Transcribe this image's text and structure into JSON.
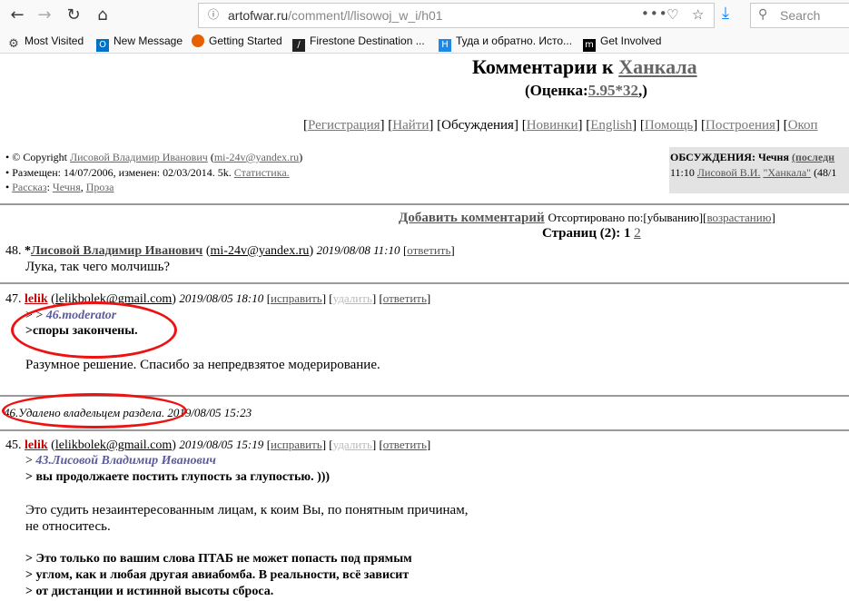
{
  "browser": {
    "url_host": "artofwar.ru",
    "url_path": "/comment/l/lisowoj_w_i/h01",
    "more_icon": "•••",
    "search_placeholder": "Search"
  },
  "bookmarks": [
    {
      "label": "Most Visited",
      "icon": "gear-icon"
    },
    {
      "label": "New Message",
      "icon": "outlook-icon"
    },
    {
      "label": "Getting Started",
      "icon": "firefox-icon"
    },
    {
      "label": "Firestone Destination ...",
      "icon": "firestone-icon"
    },
    {
      "label": "Туда и обратно. Исто...",
      "icon": "bookmark-site-icon"
    },
    {
      "label": "Get Involved",
      "icon": "mozilla-icon"
    }
  ],
  "page": {
    "title_prefix": "Комментарии к",
    "title_link": "Ханкала",
    "rating_open": "(Оценка:",
    "rating_value": "5.95*32",
    "rating_close": ",)",
    "menu": [
      {
        "label": "Регистрация",
        "link": true
      },
      {
        "label": "Найти",
        "link": true
      },
      {
        "label": "Обсуждения",
        "link": false
      },
      {
        "label": "Новинки",
        "link": true
      },
      {
        "label": "English",
        "link": true
      },
      {
        "label": "Помощь",
        "link": true
      },
      {
        "label": "Построения",
        "link": true
      },
      {
        "label": "Окоп",
        "link": true
      }
    ],
    "info": {
      "copyright_prefix": "© Copyright",
      "author": "Лисовой Владимир Иванович",
      "email": "mi-24v@yandex.ru",
      "posted": "Размещен: 14/07/2006, изменен: 02/03/2014. 5k.",
      "stats": "Статистика.",
      "tags": [
        "Рассказ",
        "Чечня",
        "Проза"
      ]
    },
    "discussions": {
      "heading": "ОБСУЖДЕНИЯ: Чечня",
      "last_label": "(последн",
      "time": "11:10",
      "author": "Лисовой В.И.",
      "title": "\"Ханкала\"",
      "count": "(48/1"
    },
    "add_comment": "Добавить комментарий",
    "sorted_label": "Отсортировано по:",
    "sort_desc": "[убыванию]",
    "sort_asc": "возрастанию",
    "pages_label": "Страниц (2):",
    "page_current": "1",
    "page_next": "2"
  },
  "comments": [
    {
      "num": "48.",
      "star": "*",
      "author": "Лисовой Владимир Иванович",
      "email": "mi-24v@yandex.ru",
      "date": "2019/08/08 11:10",
      "reply": "ответить",
      "text": "Лука, так чего молчишь?"
    },
    {
      "num": "47.",
      "author": "lelik",
      "email": "lelikbolek@gmail.com",
      "date": "2019/08/05 18:10",
      "edit": "исправить",
      "delete": "удалить",
      "reply": "ответить",
      "quote_prefix": "> >",
      "quote_ref": "46.moderator",
      "quote_line": ">споры закончены.",
      "text": "Разумное решение. Спасибо за непредвзятое модерирование."
    },
    {
      "num": "46.",
      "deleted": "Удалено владельцем раздела. 2019/08/05 15:23"
    },
    {
      "num": "45.",
      "author": "lelik",
      "email": "lelikbolek@gmail.com",
      "date": "2019/08/05 15:19",
      "edit": "исправить",
      "delete": "удалить",
      "reply": "ответить",
      "quote_prefix": ">",
      "quote_ref": "43.Лисовой Владимир Иванович",
      "quote_line": "> вы продолжаете постить глупость за глупостью. )))",
      "text1": "Это судить незаинтересованным лицам, к коим Вы, по понятным причинам,",
      "text2": "не относитесь.",
      "quote2": [
        "> Это только по вашим слова ПТАБ не может попасть под прямым",
        "> углом, как и любая другая авиабомба. В реальности, всё зависит",
        "> от дистанции и истинной высоты сброса."
      ]
    }
  ]
}
